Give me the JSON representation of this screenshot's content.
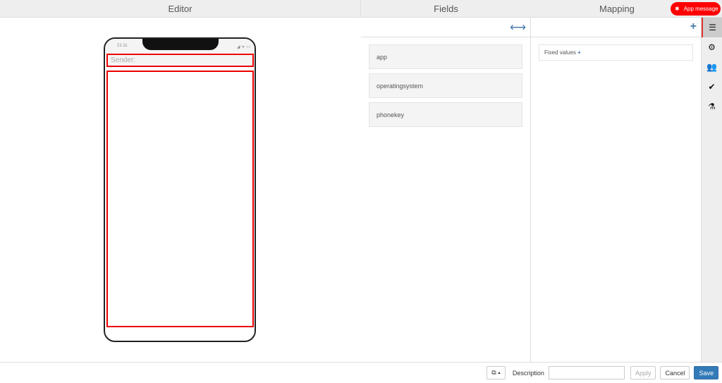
{
  "headers": {
    "editor": "Editor",
    "fields": "Fields",
    "mapping": "Mapping"
  },
  "app_message": "App message",
  "phone": {
    "time": "21:11",
    "sender_placeholder": "Sender:"
  },
  "fields": [
    "app",
    "operatingsystem",
    "phonekey"
  ],
  "mapping": {
    "fixed_values": "Fixed values"
  },
  "footer": {
    "description_label": "Description",
    "description_value": "",
    "apply": "Apply",
    "cancel": "Cancel",
    "save": "Save"
  },
  "colors": {
    "accent": "#337ab7",
    "alert": "#ff0000"
  }
}
